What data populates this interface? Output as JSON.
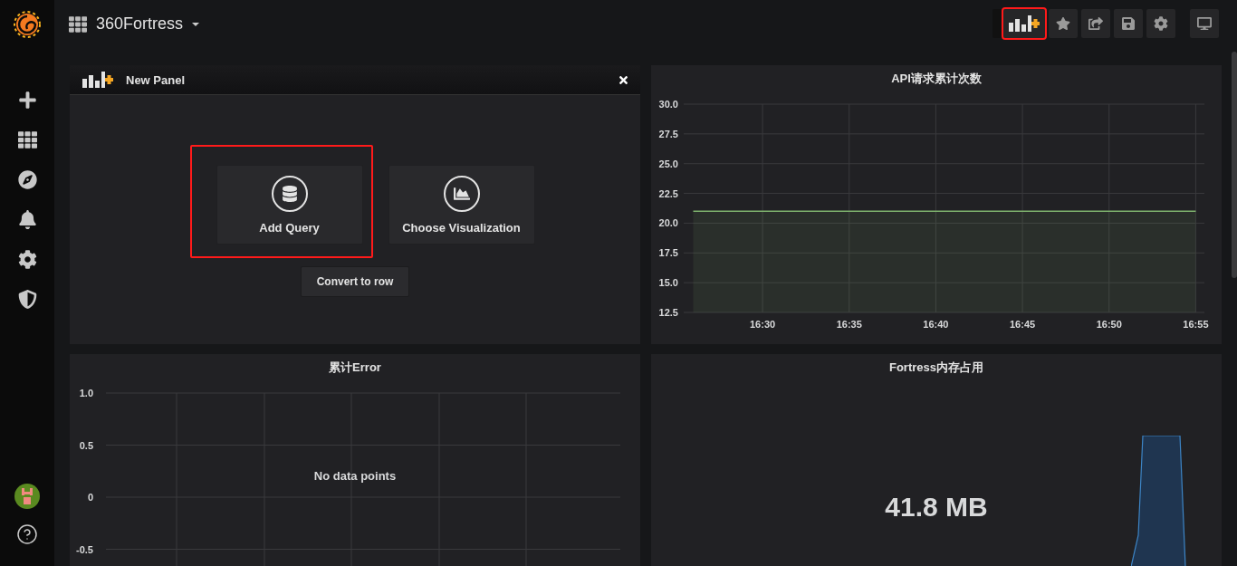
{
  "dashboard": {
    "title": "360Fortress"
  },
  "toolbar": {
    "buttons": [
      {
        "kind": "add-panel",
        "highlighted": true
      },
      {
        "kind": "star",
        "highlighted": false
      },
      {
        "kind": "share",
        "highlighted": false
      },
      {
        "kind": "save",
        "highlighted": false
      },
      {
        "kind": "settings",
        "highlighted": false
      },
      {
        "kind": "tv",
        "highlighted": false
      }
    ]
  },
  "panels": [
    {
      "kind": "new-panel",
      "title": "New Panel",
      "actions": [
        {
          "label": "Add Query",
          "highlighted": true
        },
        {
          "label": "Choose Visualization",
          "highlighted": false
        }
      ],
      "convert_button": "Convert to row"
    },
    {
      "kind": "graph",
      "title": "API请求累计次数",
      "chart_data": {
        "type": "area",
        "grid": true,
        "categories": [
          null,
          null,
          null,
          null,
          "16:30",
          null,
          null,
          null,
          null,
          "16:35",
          null,
          null,
          null,
          null,
          "16:40",
          null,
          null,
          null,
          null,
          "16:45",
          null,
          null,
          null,
          null,
          "16:50",
          null,
          null,
          null,
          null,
          "16:55"
        ],
        "series": [
          {
            "color": "#7eb26d",
            "values": [
              21,
              21,
              21,
              21,
              21,
              21,
              21,
              21,
              21,
              21,
              21,
              21,
              21,
              21,
              21,
              21,
              21,
              21,
              21,
              21,
              21,
              21,
              21,
              21,
              21,
              21,
              21,
              21,
              21,
              21
            ]
          }
        ],
        "ylim": [
          12.5,
          30
        ],
        "yticks": [
          {
            "value": 12.5,
            "label": "12.5"
          },
          {
            "value": 15,
            "label": "15.0"
          },
          {
            "value": 17.5,
            "label": "17.5"
          },
          {
            "value": 20,
            "label": "20.0"
          },
          {
            "value": 22.5,
            "label": "22.5"
          },
          {
            "value": 25,
            "label": "25.0"
          },
          {
            "value": 27.5,
            "label": "27.5"
          },
          {
            "value": 30,
            "label": "30.0"
          }
        ]
      }
    },
    {
      "kind": "empty-graph",
      "title": "累计Error",
      "y_ticks": [
        "1.0",
        "0.5",
        "0",
        "-0.5"
      ],
      "message": "No data points"
    },
    {
      "kind": "singlestat",
      "title": "Fortress内存占用",
      "value": "41.8 MB"
    }
  ]
}
